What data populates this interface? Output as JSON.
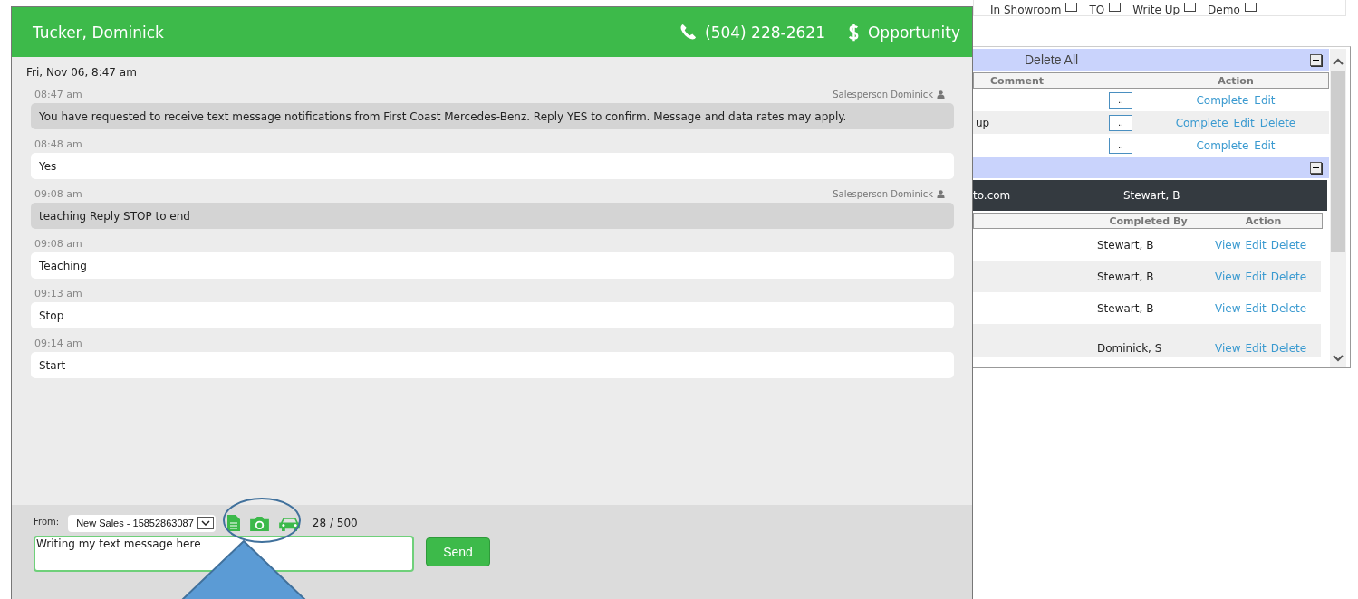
{
  "background": {
    "checkboxes": [
      {
        "label": "In Showroom",
        "checked": false
      },
      {
        "label": "TO",
        "checked": false
      },
      {
        "label": "Write Up",
        "checked": false
      },
      {
        "label": "Demo",
        "checked": false
      }
    ],
    "tasks": {
      "header": "Delete All",
      "columns": [
        "Comment",
        "Action"
      ],
      "rows": [
        {
          "comment": "",
          "more": "..",
          "actions": [
            "Complete",
            "Edit"
          ]
        },
        {
          "comment": "up",
          "more": "..",
          "actions": [
            "Complete",
            "Edit",
            "Delete"
          ]
        },
        {
          "comment": "",
          "more": "..",
          "actions": [
            "Complete",
            "Edit"
          ]
        }
      ]
    },
    "history": {
      "highlight": [
        "to.com",
        "Stewart, B"
      ],
      "columns": [
        "Completed By",
        "Action"
      ],
      "rows": [
        {
          "completed_by": "Stewart, B",
          "actions": [
            "View",
            "Edit",
            "Delete"
          ]
        },
        {
          "completed_by": "Stewart, B",
          "actions": [
            "View",
            "Edit",
            "Delete"
          ]
        },
        {
          "completed_by": "Stewart, B",
          "actions": [
            "View",
            "Edit",
            "Delete"
          ]
        },
        {
          "completed_by": "Dominick, S",
          "actions": [
            "View",
            "Edit",
            "Delete"
          ]
        }
      ]
    }
  },
  "modal": {
    "name": "Tucker, Dominick",
    "phone": "(504) 228-2621",
    "opportunity": "Opportunity",
    "date": "Fri, Nov 06, 8:47 am",
    "messages": [
      {
        "kind": "outgoing",
        "time": "08:47 am",
        "sender": "Salesperson Dominick",
        "text": "You have requested to receive text message notifications from First Coast Mercedes-Benz. Reply YES to confirm. Message and data rates may apply."
      },
      {
        "kind": "incoming",
        "time": "08:48 am",
        "text": "Yes"
      },
      {
        "kind": "outgoing",
        "time": "09:08 am",
        "sender": "Salesperson Dominick",
        "text": "teaching Reply STOP to end"
      },
      {
        "kind": "incoming",
        "time": "09:08 am",
        "text": "Teaching"
      },
      {
        "kind": "incoming",
        "time": "09:13 am",
        "text": "Stop"
      },
      {
        "kind": "incoming",
        "time": "09:14 am",
        "text": "Start"
      }
    ],
    "composer": {
      "from_label": "From:",
      "from_value": "New Sales - 15852863087",
      "count": "28 / 500",
      "message": "Writing my text message here",
      "send": "Send"
    }
  }
}
